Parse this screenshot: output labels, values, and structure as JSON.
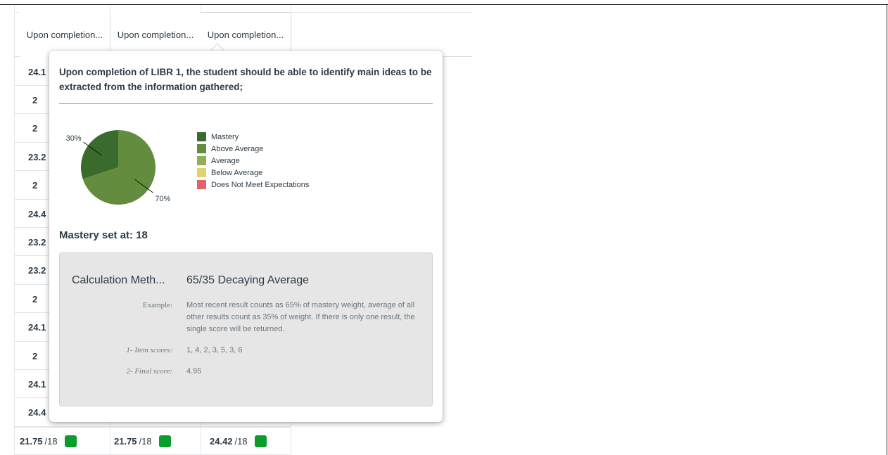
{
  "table": {
    "headers": [
      "Upon completion...",
      "Upon completion...",
      "Upon completion..."
    ],
    "left_values": [
      "24.1",
      "2",
      "2",
      "23.2",
      "2",
      "24.4",
      "23.2",
      "23.2",
      "2",
      "24.1",
      "2",
      "24.1",
      "24.4"
    ],
    "bottom_row": [
      {
        "score": "21.75",
        "suffix": "/18"
      },
      {
        "score": "21.75",
        "suffix": "/18"
      },
      {
        "score": "24.42",
        "suffix": "/18"
      }
    ]
  },
  "popover": {
    "title": "Upon completion of LIBR 1, the student should be able to identify main ideas to be extracted from the information gathered;",
    "mastery_text": "Mastery set at: 18",
    "calculation": {
      "label": "Calculation Meth...",
      "value": "65/35 Decaying Average",
      "example_key": "Example:",
      "example_value": "Most recent result counts as 65% of mastery weight, average of all other results count as 35% of weight. If there is only one result, the single score will be returned.",
      "item_scores_key": "1- Item scores:",
      "item_scores_value": "1, 4, 2, 3, 5, 3, 6",
      "final_score_key": "2- Final score:",
      "final_score_value": "4.95"
    }
  },
  "chart_data": {
    "type": "pie",
    "slices": [
      {
        "label": "Mastery",
        "value": 30,
        "color": "#3b6a2d"
      },
      {
        "label": "Above Average",
        "value": 70,
        "color": "#648c3f"
      }
    ],
    "slice_labels": [
      "30%",
      "70%"
    ],
    "legend": [
      {
        "label": "Mastery",
        "color": "#3b6a2d"
      },
      {
        "label": "Above Average",
        "color": "#648c3f"
      },
      {
        "label": "Average",
        "color": "#8fae55"
      },
      {
        "label": "Below Average",
        "color": "#e0d36a"
      },
      {
        "label": "Does Not Meet Expectations",
        "color": "#e0626a"
      }
    ],
    "legend_position": "right"
  },
  "colors": {
    "mastery_badge": "#0b9c2e"
  }
}
